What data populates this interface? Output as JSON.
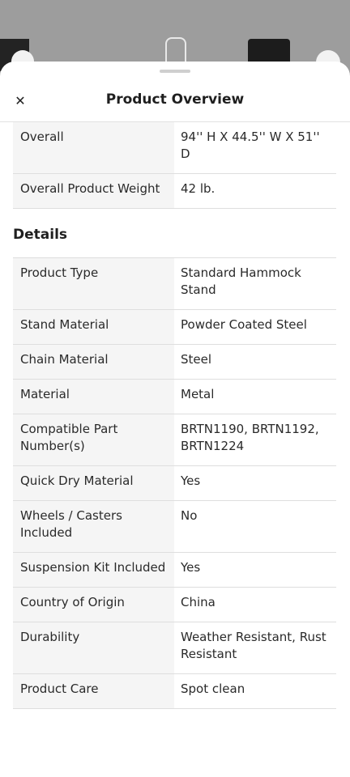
{
  "header": {
    "title": "Product Overview"
  },
  "dimensions_rows": [
    {
      "key": "Overall",
      "value": "94'' H X 44.5'' W X 51'' D"
    },
    {
      "key": "Overall Product Weight",
      "value": "42 lb."
    }
  ],
  "details_heading": "Details",
  "details_rows": [
    {
      "key": "Product Type",
      "value": "Standard Hammock Stand"
    },
    {
      "key": "Stand Material",
      "value": "Powder Coated Steel"
    },
    {
      "key": "Chain Material",
      "value": "Steel"
    },
    {
      "key": "Material",
      "value": "Metal"
    },
    {
      "key": "Compatible Part Number(s)",
      "value": "BRTN1190, BRTN1192, BRTN1224"
    },
    {
      "key": "Quick Dry Material",
      "value": "Yes"
    },
    {
      "key": "Wheels / Casters Included",
      "value": "No"
    },
    {
      "key": "Suspension Kit Included",
      "value": "Yes"
    },
    {
      "key": "Country of Origin",
      "value": "China"
    },
    {
      "key": "Durability",
      "value": "Weather Resistant, Rust Resistant"
    },
    {
      "key": "Product Care",
      "value": "Spot clean"
    }
  ],
  "icons": {
    "close": "close-icon",
    "back": "chevron-left-icon",
    "share": "share-icon"
  }
}
